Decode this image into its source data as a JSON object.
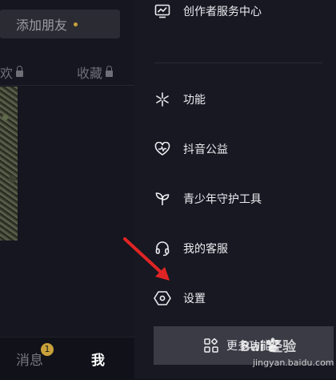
{
  "profile": {
    "add_friend_label": "添加朋友",
    "tab_likes": "喜欢",
    "tab_favorites": "收藏"
  },
  "bottom_nav": {
    "messages_label": "消息",
    "messages_badge": "1",
    "me_label": "我"
  },
  "menu": {
    "creator_center": "创作者服务中心",
    "functions": "功能",
    "charity": "抖音公益",
    "teen_protection": "青少年守护工具",
    "customer_service": "我的客服",
    "settings": "设置",
    "more_functions": "更多功能"
  },
  "watermark": {
    "brand": "Bai 经验",
    "url": "jingyan.baidu.com"
  },
  "colors": {
    "accent": "#c9a13a",
    "arrow": "#e02424"
  },
  "icons": [
    "monitor-chart-icon",
    "asterisk-icon",
    "heart-charity-icon",
    "sprout-icon",
    "headset-icon",
    "hexagon-settings-icon",
    "grid-apps-icon",
    "paw-icon",
    "lock-icon"
  ]
}
